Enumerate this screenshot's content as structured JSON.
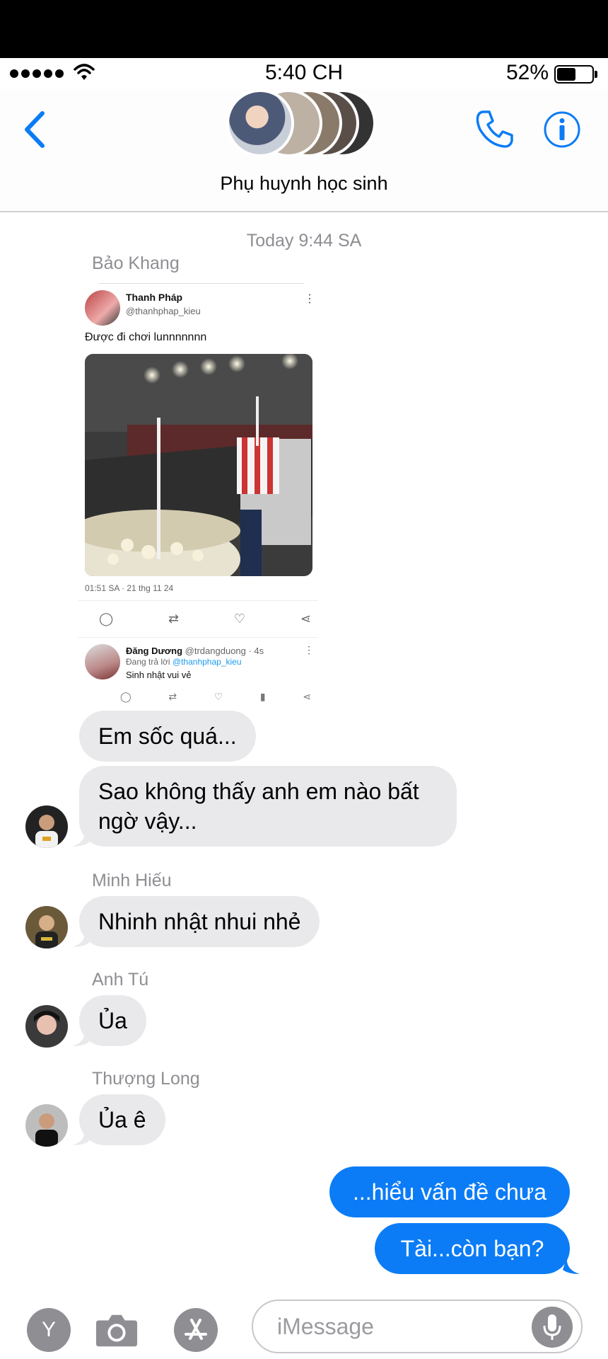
{
  "status": {
    "time": "5:40 CH",
    "battery": "52%",
    "battery_level": 0.52
  },
  "header": {
    "title": "Phụ huynh học sinh"
  },
  "conversation": {
    "timestamp": "Today 9:44 SA",
    "senders": [
      "Bảo Khang",
      "Minh Hiếu",
      "Anh Tú",
      "Thượng Long"
    ]
  },
  "tweet": {
    "name": "Thanh Pháp",
    "handle": "@thanhphap_kieu",
    "text": "Được đi chơi lunnnnnnn",
    "meta": "01:51 SA · 21 thg 11 24",
    "reply": {
      "name": "Đăng Dương",
      "handle": "@trdangduong · 4s",
      "replying": "Đang trả lời",
      "mention": "@thanhphap_kieu",
      "text": "Sinh nhật vui vẻ"
    }
  },
  "messages": {
    "m1": "Em sốc quá...",
    "m2_line1": "Sao không thấy anh em nào bất",
    "m2_line2": "ngờ vậy...",
    "m3": "Nhinh nhật nhui nhẻ",
    "m4": "Ủa",
    "m5": "Ủa ê",
    "m6": "...hiểu vấn đề chưa",
    "m7": "Tài...còn bạn?"
  },
  "input": {
    "placeholder": "iMessage",
    "memoji_letter": "Y"
  },
  "colors": {
    "accent": "#0b7cf6",
    "bubble_gray": "#e9e9eb",
    "secondary_text": "#8e8e93"
  }
}
